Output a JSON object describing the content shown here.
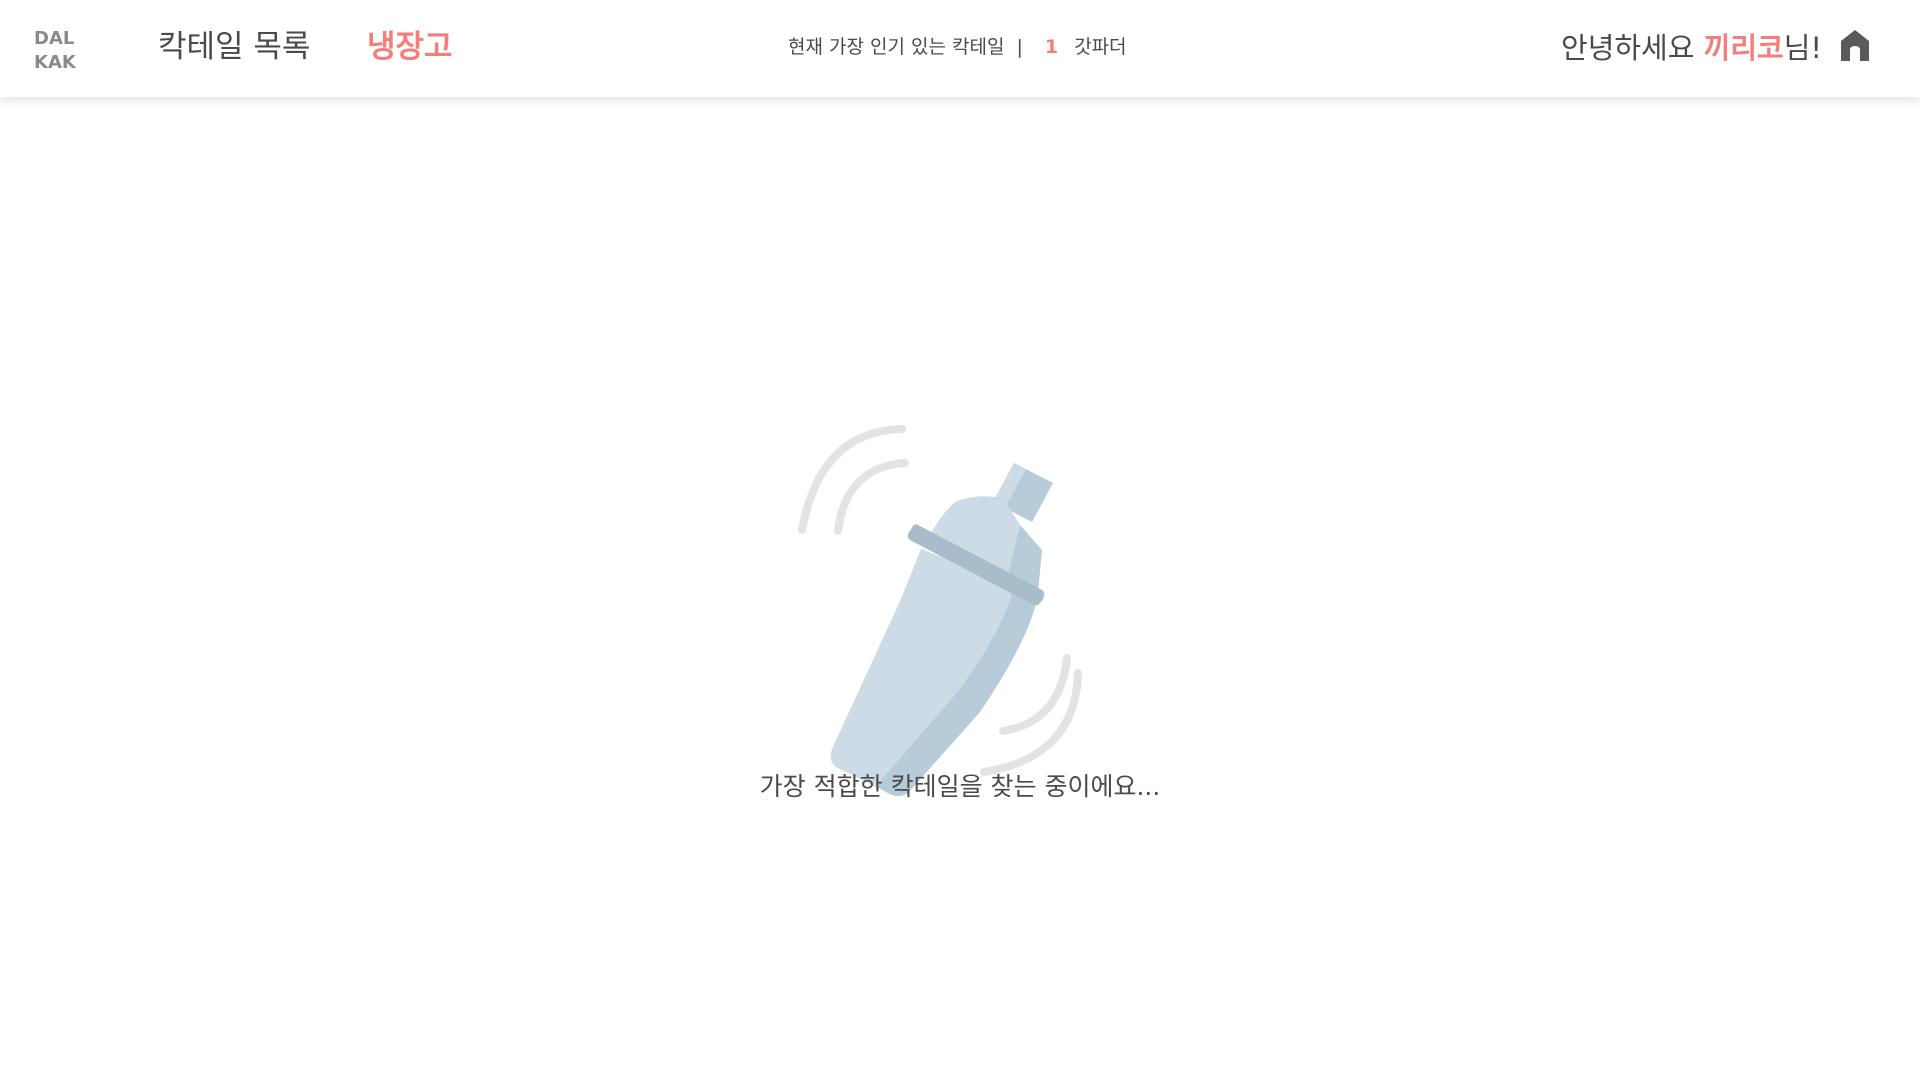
{
  "header": {
    "logo": {
      "line1": "DAL",
      "line2": "KAK"
    },
    "nav": {
      "cocktail_list": "칵테일 목록",
      "fridge": "냉장고"
    },
    "popular": {
      "label": "현재 가장 인기 있는 칵테일",
      "separator": "|",
      "rank": "1",
      "cocktail_name": "갓파더"
    },
    "greeting": {
      "prefix": "안녕하세요 ",
      "username": "끼리코",
      "suffix": "님!"
    },
    "home_icon": "home-icon"
  },
  "main": {
    "loading_icon": "cocktail-shaker-icon",
    "loading_text": "가장 적합한 칵테일을 찾는 중이에요..."
  },
  "colors": {
    "accent": "#f47e7b",
    "text": "#4a4a4a",
    "logo": "#8a8a8a",
    "shaker_light": "#cddbe6",
    "shaker_dark": "#b8cbd9",
    "shaker_band": "#a9bcc9",
    "motion_lines": "#e3e3e3"
  }
}
